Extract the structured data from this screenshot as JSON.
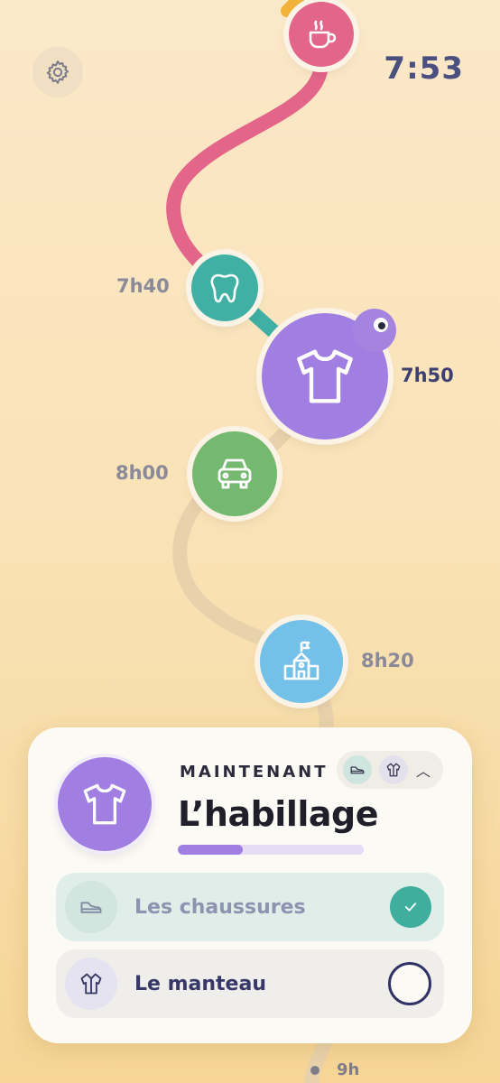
{
  "header": {
    "clock": "7:53",
    "settings_icon": "gear-icon"
  },
  "timeline": {
    "steps": [
      {
        "id": "breakfast",
        "icon": "coffee-cup-icon",
        "time": "",
        "color": "#e3658a"
      },
      {
        "id": "teeth",
        "icon": "tooth-icon",
        "time": "7h40",
        "color": "#3fb0a3"
      },
      {
        "id": "dressing",
        "icon": "t-shirt-icon",
        "time": "7h50",
        "color": "#a07ee2",
        "active": true
      },
      {
        "id": "car",
        "icon": "car-icon",
        "time": "8h00",
        "color": "#74b96f"
      },
      {
        "id": "school",
        "icon": "school-icon",
        "time": "8h20",
        "color": "#73c0e8"
      }
    ],
    "next_time": "9h"
  },
  "card": {
    "now_label": "MAINTENANT",
    "title": "L’habillage",
    "progress": 0.35,
    "progress_color": "#a07ee2",
    "mini_icons": [
      "shoe-icon",
      "coat-icon"
    ],
    "subtasks": [
      {
        "label": "Les chaussures",
        "icon": "shoe-icon",
        "done": true
      },
      {
        "label": "Le manteau",
        "icon": "coat-icon",
        "done": false
      }
    ]
  }
}
